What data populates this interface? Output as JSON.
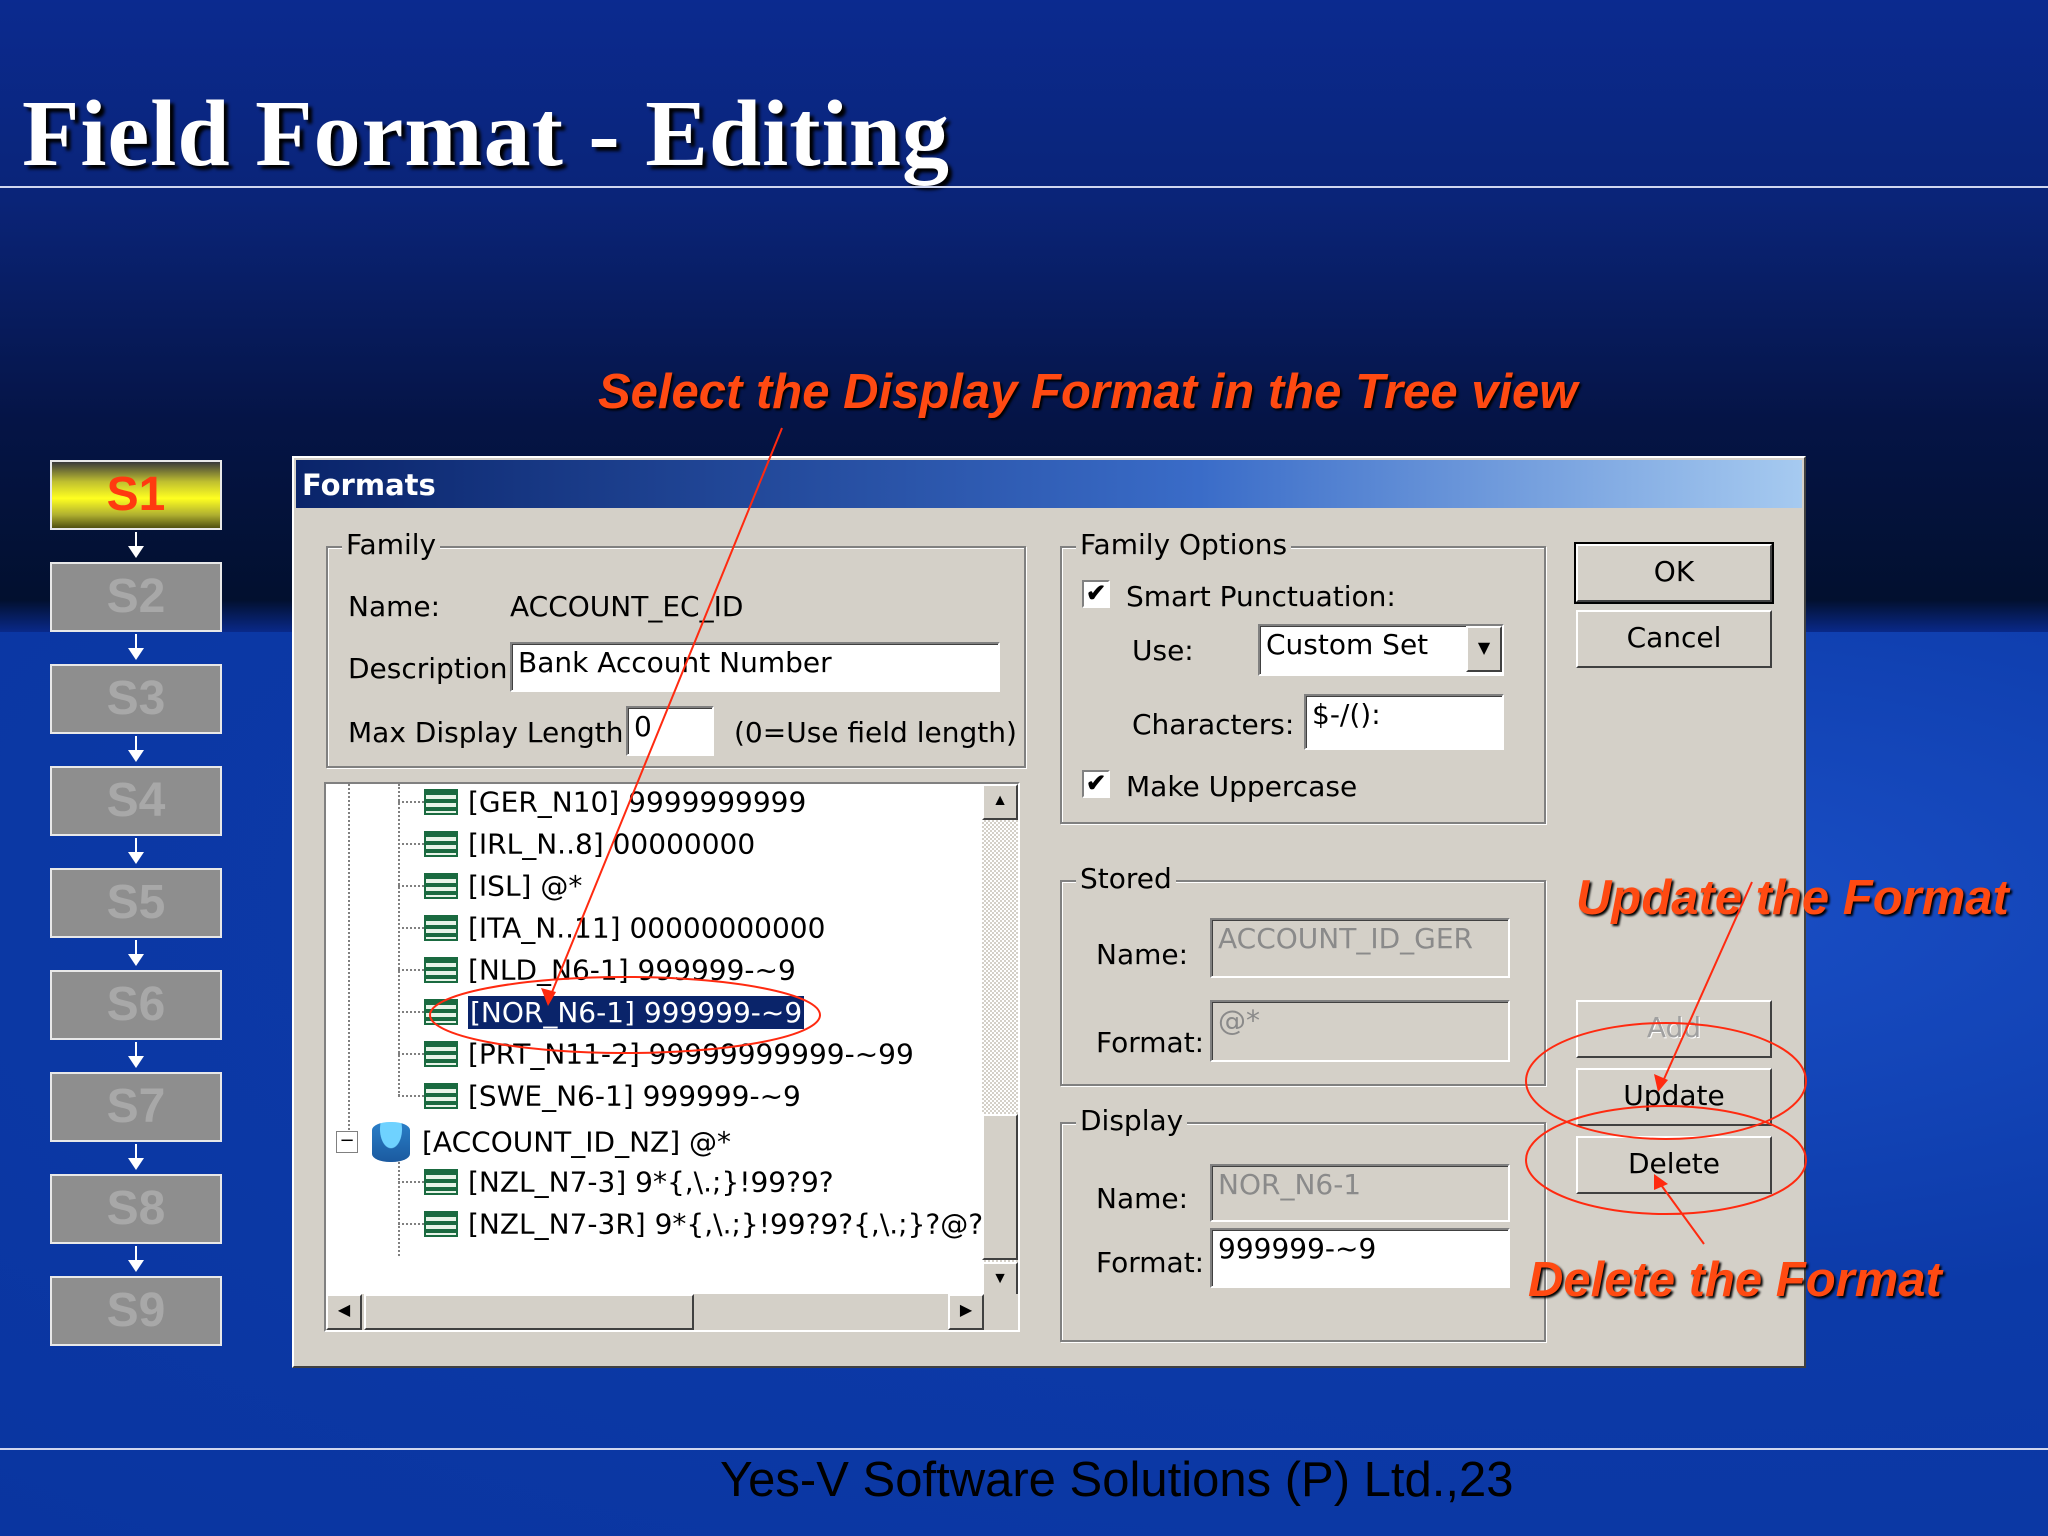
{
  "slide": {
    "title": "Field Format - Editing",
    "footer": "Yes-V Software Solutions (P) Ltd.,23"
  },
  "annotations": {
    "select": "Select the Display Format in the Tree view",
    "update": "Update the Format",
    "delete": "Delete the Format"
  },
  "steps": [
    "S1",
    "S2",
    "S3",
    "S4",
    "S5",
    "S6",
    "S7",
    "S8",
    "S9"
  ],
  "active_step": "S1",
  "dialog": {
    "title": "Formats",
    "family": {
      "group_label": "Family",
      "name_label": "Name:",
      "name_value": "ACCOUNT_EC_ID",
      "description_label": "Description:",
      "description_value": "Bank Account Number",
      "max_len_label": "Max Display Length:",
      "max_len_value": "0",
      "max_len_hint": "(0=Use field length)"
    },
    "tree": [
      {
        "text": "[GER_N10] 9999999999",
        "selected": false
      },
      {
        "text": "[IRL_N..8] 00000000",
        "selected": false
      },
      {
        "text": "[ISL] @*",
        "selected": false
      },
      {
        "text": "[ITA_N..11] 00000000000",
        "selected": false
      },
      {
        "text": "[NLD_N6-1] 999999-~9",
        "selected": false
      },
      {
        "text": "[NOR_N6-1] 999999-~9",
        "selected": true
      },
      {
        "text": "[PRT_N11-2] 99999999999-~99",
        "selected": false
      },
      {
        "text": "[SWE_N6-1] 999999-~9",
        "selected": false
      },
      {
        "text": "[ACCOUNT_ID_NZ] @*",
        "selected": false,
        "root": true
      },
      {
        "text": "[NZL_N7-3] 9*{,\\.;}!99?9?",
        "selected": false
      },
      {
        "text": "[NZL_N7-3R] 9*{,\\.;}!99?9?{,\\.;}?@?@?",
        "selected": false
      }
    ],
    "family_options": {
      "group_label": "Family Options",
      "smart_punct_label": "Smart Punctuation:",
      "smart_punct_checked": true,
      "use_label": "Use:",
      "use_value": "Custom Set",
      "characters_label": "Characters:",
      "characters_value": "$-/():",
      "uppercase_label": "Make Uppercase",
      "uppercase_checked": true
    },
    "stored": {
      "group_label": "Stored",
      "name_label": "Name:",
      "name_value": "ACCOUNT_ID_GER",
      "format_label": "Format:",
      "format_value": "@*"
    },
    "display": {
      "group_label": "Display",
      "name_label": "Name:",
      "name_value": "NOR_N6-1",
      "format_label": "Format:",
      "format_value": "999999-~9"
    },
    "buttons": {
      "ok": "OK",
      "cancel": "Cancel",
      "add": "Add",
      "update": "Update",
      "delete": "Delete"
    }
  },
  "colors": {
    "annotation": "#ff4a12",
    "dialog_bg": "#d4d0c8",
    "selection": "#0a246a"
  }
}
